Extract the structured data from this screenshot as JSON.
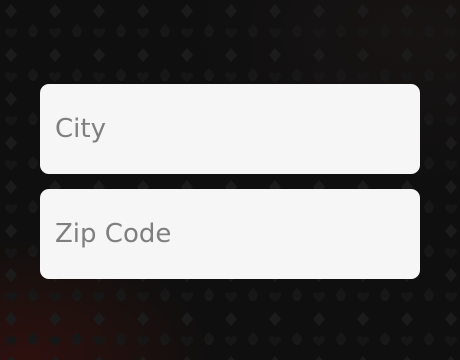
{
  "form": {
    "city": {
      "placeholder": "City",
      "value": ""
    },
    "zip": {
      "placeholder": "Zip Code",
      "value": ""
    }
  },
  "theme": {
    "background": "#0f0f0f",
    "field_background": "#f6f6f6",
    "placeholder_color": "#7f7f7f",
    "pattern_icon": "card-suit-pattern"
  }
}
